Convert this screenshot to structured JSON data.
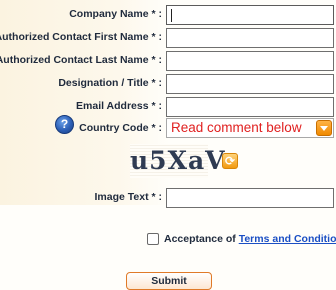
{
  "form": {
    "company_name_label": "Company Name * :",
    "first_name_label": "Authorized Contact First Name * :",
    "last_name_label": "Authorized Contact Last Name * :",
    "designation_label": "Designation / Title * :",
    "email_label": "Email Address * :",
    "country_code_label": "Country Code * :",
    "country_code_value": "Read comment below",
    "captcha_text": "u5XaV",
    "image_text_label": "Image Text * :",
    "acceptance_prefix": "Acceptance of",
    "acceptance_link": "Terms and Condition",
    "submit_label": "Submit"
  },
  "icons": {
    "help": "question-mark-circle",
    "refresh": "refresh-arrows",
    "select_arrow": "chevron-down"
  },
  "colors": {
    "label_text": "#1f2a3c",
    "select_value": "#e02020",
    "link": "#1b4fc4",
    "accent": "#f08a00"
  }
}
